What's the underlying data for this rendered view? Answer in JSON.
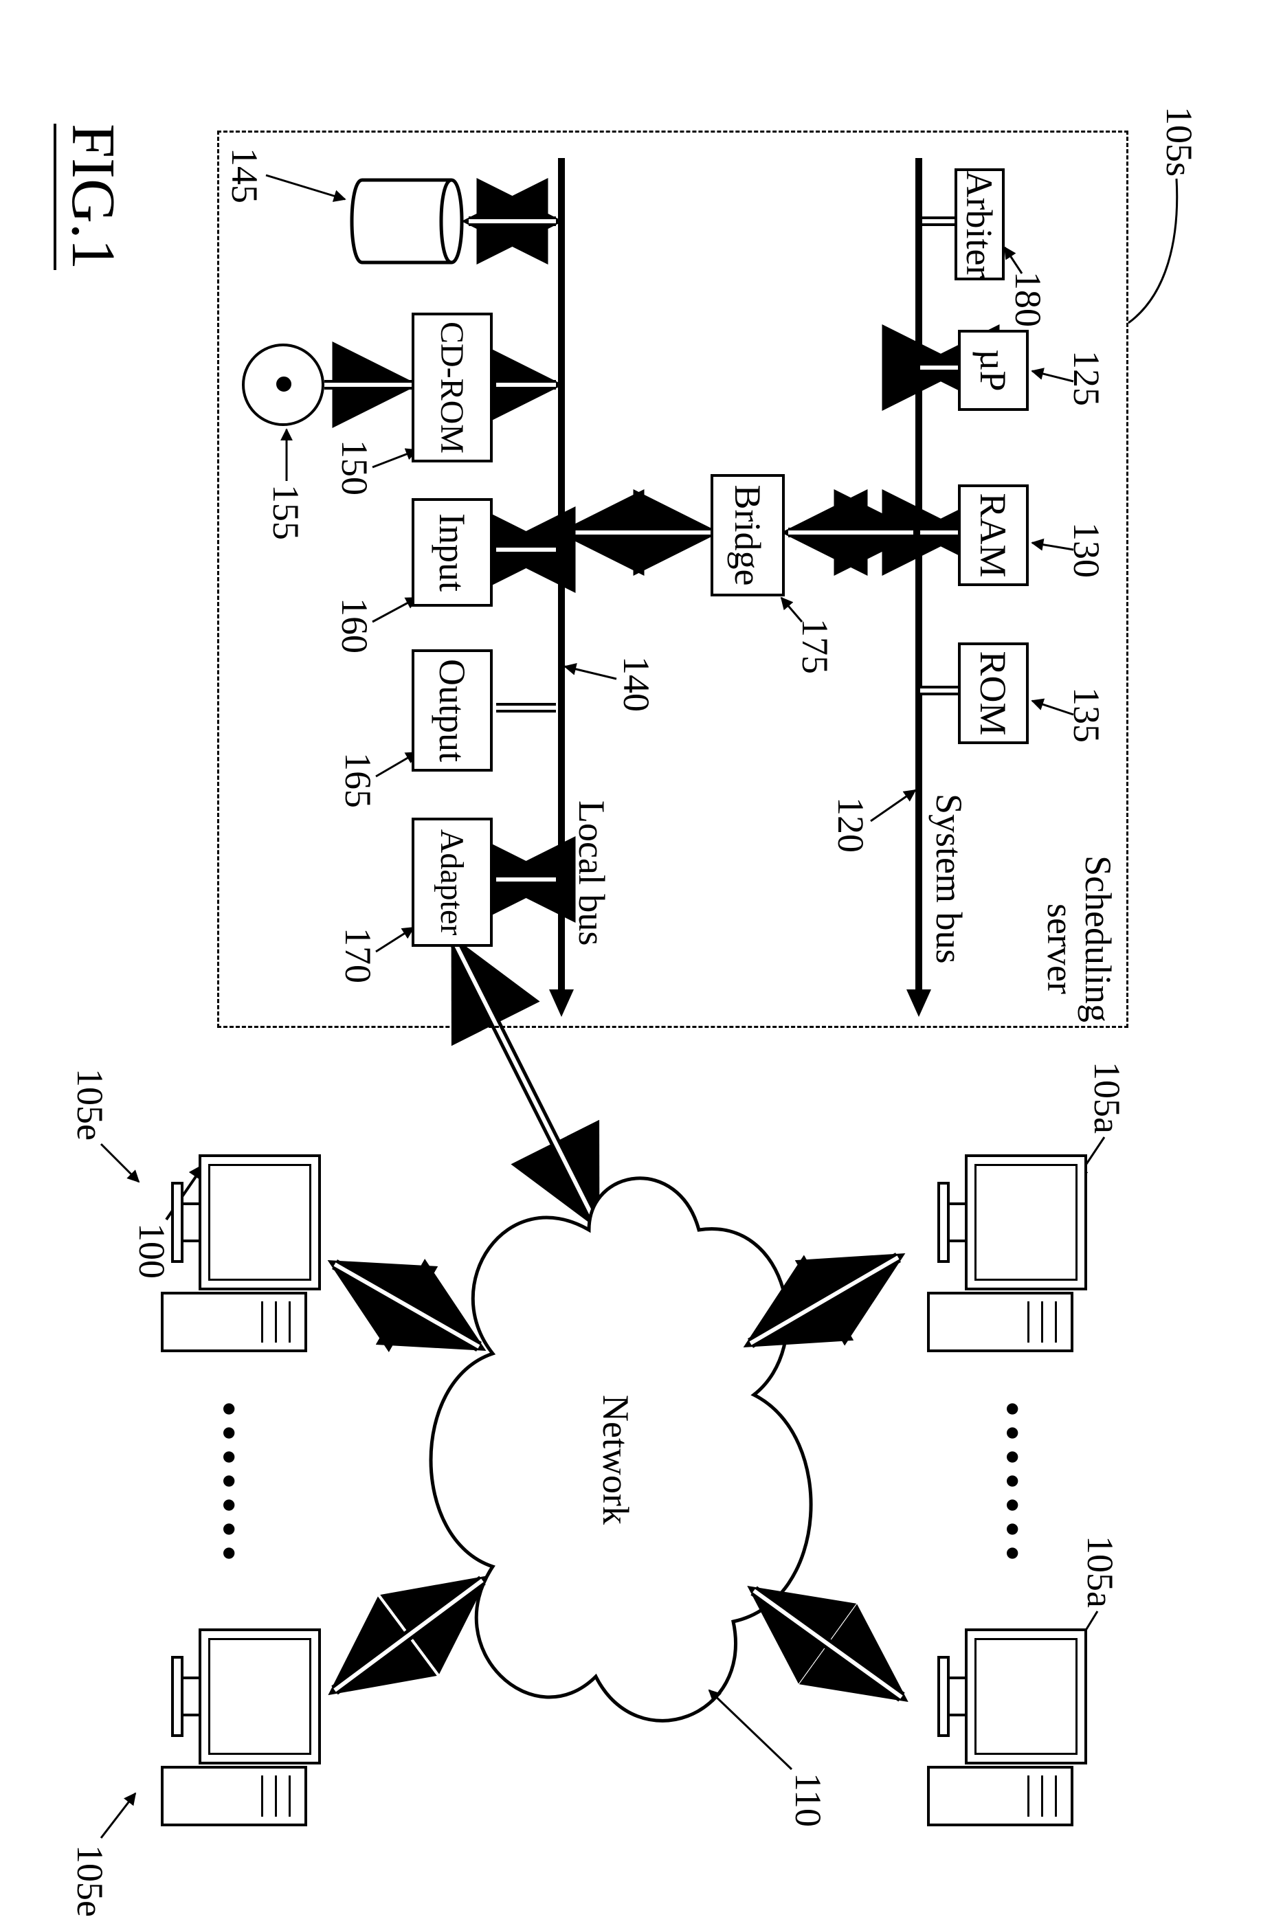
{
  "figure": {
    "label": "FIG.1",
    "id_pointer": "100"
  },
  "server": {
    "title_line1": "Scheduling",
    "title_line2": "server",
    "ref": "105s",
    "buses": {
      "system": {
        "label": "System bus",
        "ref": "120"
      },
      "local": {
        "label": "Local bus",
        "ref": "140"
      }
    },
    "blocks": {
      "arbiter": {
        "label": "Arbiter",
        "ref": "180"
      },
      "uP": {
        "label": "µP",
        "ref": "125"
      },
      "ram": {
        "label": "RAM",
        "ref": "130"
      },
      "rom": {
        "label": "ROM",
        "ref": "135"
      },
      "bridge": {
        "label": "Bridge",
        "ref": "175"
      },
      "cdrom": {
        "label": "CD-ROM",
        "ref": "150"
      },
      "input": {
        "label": "Input",
        "ref": "160"
      },
      "output": {
        "label": "Output",
        "ref": "165"
      },
      "adapter": {
        "label": "Adapter",
        "ref": "170"
      }
    },
    "devices": {
      "hdd": {
        "ref": "145"
      },
      "cd": {
        "ref": "155"
      }
    }
  },
  "network": {
    "label": "Network",
    "ref": "110"
  },
  "endpoints": {
    "tl": {
      "ref": "105a"
    },
    "tr": {
      "ref": "105a"
    },
    "bl": {
      "ref": "105e"
    },
    "br": {
      "ref": "105e"
    }
  },
  "ellipsis": "•••••••"
}
